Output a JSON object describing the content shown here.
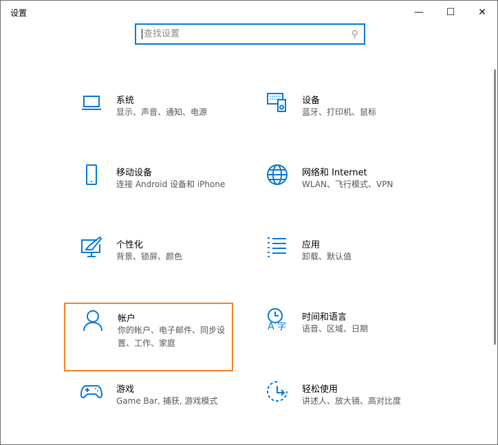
{
  "window": {
    "title": "设置",
    "minimize": "—",
    "maximize": "☐",
    "close": "✕"
  },
  "search": {
    "placeholder": "查找设置"
  },
  "items": [
    {
      "title": "系统",
      "desc": "显示、声音、通知、电源",
      "icon": "laptop-icon"
    },
    {
      "title": "设备",
      "desc": "蓝牙、打印机、鼠标",
      "icon": "devices-icon"
    },
    {
      "title": "移动设备",
      "desc": "连接 Android 设备和 iPhone",
      "icon": "phone-icon"
    },
    {
      "title": "网络和 Internet",
      "desc": "WLAN、飞行模式、VPN",
      "icon": "globe-icon"
    },
    {
      "title": "个性化",
      "desc": "背景、锁屏、颜色",
      "icon": "paint-icon"
    },
    {
      "title": "应用",
      "desc": "卸载、默认值",
      "icon": "apps-list-icon"
    },
    {
      "title": "帐户",
      "desc": "你的帐户、电子邮件、同步设置、工作、家庭",
      "icon": "person-icon"
    },
    {
      "title": "时间和语言",
      "desc": "语音、区域、日期",
      "icon": "time-language-icon"
    },
    {
      "title": "游戏",
      "desc": "Game Bar, 捕获, 游戏模式",
      "icon": "gamepad-icon"
    },
    {
      "title": "轻松使用",
      "desc": "讲述人、放大镜、高对比度",
      "icon": "accessibility-icon"
    }
  ],
  "colors": {
    "accent": "#0078d7",
    "highlight": "#f7801e"
  }
}
